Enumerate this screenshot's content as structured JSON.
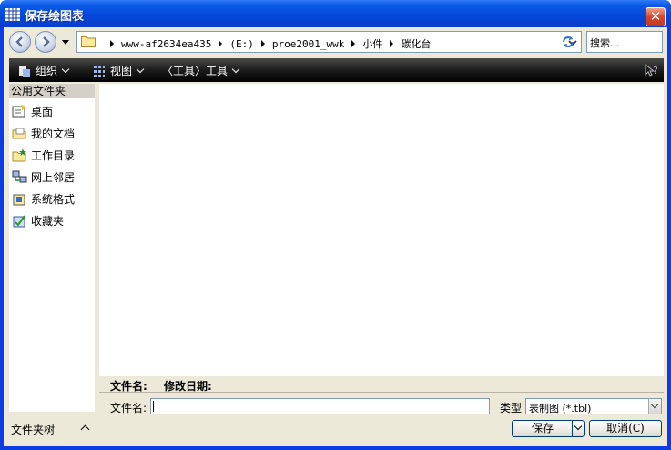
{
  "window": {
    "title": "保存绘图表",
    "close_symbol": "✕"
  },
  "address": {
    "crumbs": [
      "www-af2634ea435",
      "(E:)",
      "proe2001_wwk",
      "小件",
      "碳化台"
    ],
    "search_placeholder": "搜索..."
  },
  "toolbar": {
    "organize": "组织",
    "view": "视图",
    "tools": "〈工具〉工具"
  },
  "sidebar": {
    "header": "公用文件夹",
    "items": [
      {
        "label": "桌面",
        "icon": "desktop-icon"
      },
      {
        "label": "我的文档",
        "icon": "documents-icon"
      },
      {
        "label": "工作目录",
        "icon": "working-dir-icon"
      },
      {
        "label": "网上邻居",
        "icon": "network-icon"
      },
      {
        "label": "系统格式",
        "icon": "system-format-icon"
      },
      {
        "label": "收藏夹",
        "icon": "favorites-icon"
      }
    ],
    "folder_tree": "文件夹树"
  },
  "details": {
    "name_col": "文件名:",
    "modified_col": "修改日期:"
  },
  "form": {
    "filename_label": "文件名:",
    "filename_value": "",
    "type_label": "类型",
    "type_value": "表制图 (*.tbl)"
  },
  "buttons": {
    "save": "保存",
    "cancel": "取消(C)"
  },
  "colors": {
    "titlebar": "#0546d8",
    "toolbar": "#1c1c1c",
    "chrome": "#ece9d8"
  }
}
